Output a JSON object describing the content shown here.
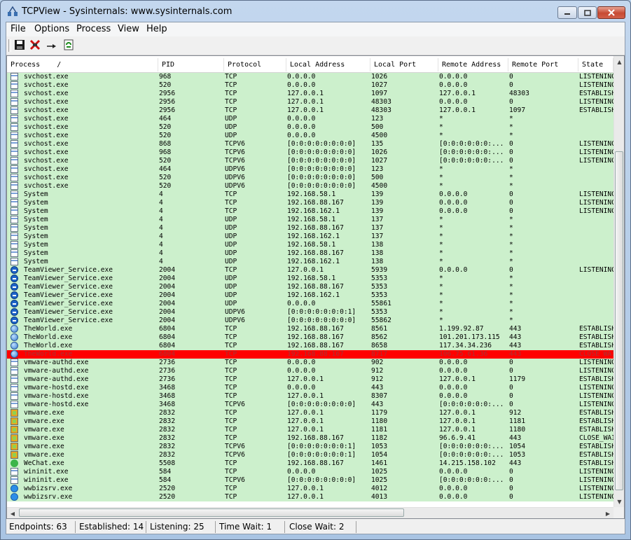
{
  "window": {
    "title": "TCPView - Sysinternals: www.sysinternals.com"
  },
  "menu": [
    "File",
    "Options",
    "Process",
    "View",
    "Help"
  ],
  "toolbar": [
    "save-icon",
    "close-connection-icon",
    "resolve-addresses-icon",
    "refresh-icon"
  ],
  "columns": [
    "Process",
    "PID",
    "Protocol",
    "Local Address",
    "Local Port",
    "Remote Address",
    "Remote Port",
    "State"
  ],
  "sort_indicator": "/",
  "rows": [
    {
      "icon": "win",
      "process": "svchost.exe",
      "pid": "968",
      "protocol": "TCP",
      "local_address": "0.0.0.0",
      "local_port": "1026",
      "remote_address": "0.0.0.0",
      "remote_port": "0",
      "state": "LISTENING"
    },
    {
      "icon": "win",
      "process": "svchost.exe",
      "pid": "520",
      "protocol": "TCP",
      "local_address": "0.0.0.0",
      "local_port": "1027",
      "remote_address": "0.0.0.0",
      "remote_port": "0",
      "state": "LISTENING"
    },
    {
      "icon": "win",
      "process": "svchost.exe",
      "pid": "2956",
      "protocol": "TCP",
      "local_address": "127.0.0.1",
      "local_port": "1097",
      "remote_address": "127.0.0.1",
      "remote_port": "48303",
      "state": "ESTABLISHED"
    },
    {
      "icon": "win",
      "process": "svchost.exe",
      "pid": "2956",
      "protocol": "TCP",
      "local_address": "127.0.0.1",
      "local_port": "48303",
      "remote_address": "0.0.0.0",
      "remote_port": "0",
      "state": "LISTENING"
    },
    {
      "icon": "win",
      "process": "svchost.exe",
      "pid": "2956",
      "protocol": "TCP",
      "local_address": "127.0.0.1",
      "local_port": "48303",
      "remote_address": "127.0.0.1",
      "remote_port": "1097",
      "state": "ESTABLISHED"
    },
    {
      "icon": "win",
      "process": "svchost.exe",
      "pid": "464",
      "protocol": "UDP",
      "local_address": "0.0.0.0",
      "local_port": "123",
      "remote_address": "*",
      "remote_port": "*",
      "state": ""
    },
    {
      "icon": "win",
      "process": "svchost.exe",
      "pid": "520",
      "protocol": "UDP",
      "local_address": "0.0.0.0",
      "local_port": "500",
      "remote_address": "*",
      "remote_port": "*",
      "state": ""
    },
    {
      "icon": "win",
      "process": "svchost.exe",
      "pid": "520",
      "protocol": "UDP",
      "local_address": "0.0.0.0",
      "local_port": "4500",
      "remote_address": "*",
      "remote_port": "*",
      "state": ""
    },
    {
      "icon": "win",
      "process": "svchost.exe",
      "pid": "868",
      "protocol": "TCPV6",
      "local_address": "[0:0:0:0:0:0:0:0]",
      "local_port": "135",
      "remote_address": "[0:0:0:0:0:0:...",
      "remote_port": "0",
      "state": "LISTENING"
    },
    {
      "icon": "win",
      "process": "svchost.exe",
      "pid": "968",
      "protocol": "TCPV6",
      "local_address": "[0:0:0:0:0:0:0:0]",
      "local_port": "1026",
      "remote_address": "[0:0:0:0:0:0:...",
      "remote_port": "0",
      "state": "LISTENING"
    },
    {
      "icon": "win",
      "process": "svchost.exe",
      "pid": "520",
      "protocol": "TCPV6",
      "local_address": "[0:0:0:0:0:0:0:0]",
      "local_port": "1027",
      "remote_address": "[0:0:0:0:0:0:...",
      "remote_port": "0",
      "state": "LISTENING"
    },
    {
      "icon": "win",
      "process": "svchost.exe",
      "pid": "464",
      "protocol": "UDPV6",
      "local_address": "[0:0:0:0:0:0:0:0]",
      "local_port": "123",
      "remote_address": "*",
      "remote_port": "*",
      "state": ""
    },
    {
      "icon": "win",
      "process": "svchost.exe",
      "pid": "520",
      "protocol": "UDPV6",
      "local_address": "[0:0:0:0:0:0:0:0]",
      "local_port": "500",
      "remote_address": "*",
      "remote_port": "*",
      "state": ""
    },
    {
      "icon": "win",
      "process": "svchost.exe",
      "pid": "520",
      "protocol": "UDPV6",
      "local_address": "[0:0:0:0:0:0:0:0]",
      "local_port": "4500",
      "remote_address": "*",
      "remote_port": "*",
      "state": ""
    },
    {
      "icon": "win",
      "process": "System",
      "pid": "4",
      "protocol": "TCP",
      "local_address": "192.168.58.1",
      "local_port": "139",
      "remote_address": "0.0.0.0",
      "remote_port": "0",
      "state": "LISTENING"
    },
    {
      "icon": "win",
      "process": "System",
      "pid": "4",
      "protocol": "TCP",
      "local_address": "192.168.88.167",
      "local_port": "139",
      "remote_address": "0.0.0.0",
      "remote_port": "0",
      "state": "LISTENING"
    },
    {
      "icon": "win",
      "process": "System",
      "pid": "4",
      "protocol": "TCP",
      "local_address": "192.168.162.1",
      "local_port": "139",
      "remote_address": "0.0.0.0",
      "remote_port": "0",
      "state": "LISTENING"
    },
    {
      "icon": "win",
      "process": "System",
      "pid": "4",
      "protocol": "UDP",
      "local_address": "192.168.58.1",
      "local_port": "137",
      "remote_address": "*",
      "remote_port": "*",
      "state": ""
    },
    {
      "icon": "win",
      "process": "System",
      "pid": "4",
      "protocol": "UDP",
      "local_address": "192.168.88.167",
      "local_port": "137",
      "remote_address": "*",
      "remote_port": "*",
      "state": ""
    },
    {
      "icon": "win",
      "process": "System",
      "pid": "4",
      "protocol": "UDP",
      "local_address": "192.168.162.1",
      "local_port": "137",
      "remote_address": "*",
      "remote_port": "*",
      "state": ""
    },
    {
      "icon": "win",
      "process": "System",
      "pid": "4",
      "protocol": "UDP",
      "local_address": "192.168.58.1",
      "local_port": "138",
      "remote_address": "*",
      "remote_port": "*",
      "state": ""
    },
    {
      "icon": "win",
      "process": "System",
      "pid": "4",
      "protocol": "UDP",
      "local_address": "192.168.88.167",
      "local_port": "138",
      "remote_address": "*",
      "remote_port": "*",
      "state": ""
    },
    {
      "icon": "win",
      "process": "System",
      "pid": "4",
      "protocol": "UDP",
      "local_address": "192.168.162.1",
      "local_port": "138",
      "remote_address": "*",
      "remote_port": "*",
      "state": ""
    },
    {
      "icon": "tv",
      "process": "TeamViewer_Service.exe",
      "pid": "2004",
      "protocol": "TCP",
      "local_address": "127.0.0.1",
      "local_port": "5939",
      "remote_address": "0.0.0.0",
      "remote_port": "0",
      "state": "LISTENING"
    },
    {
      "icon": "tv",
      "process": "TeamViewer_Service.exe",
      "pid": "2004",
      "protocol": "UDP",
      "local_address": "192.168.58.1",
      "local_port": "5353",
      "remote_address": "*",
      "remote_port": "*",
      "state": ""
    },
    {
      "icon": "tv",
      "process": "TeamViewer_Service.exe",
      "pid": "2004",
      "protocol": "UDP",
      "local_address": "192.168.88.167",
      "local_port": "5353",
      "remote_address": "*",
      "remote_port": "*",
      "state": ""
    },
    {
      "icon": "tv",
      "process": "TeamViewer_Service.exe",
      "pid": "2004",
      "protocol": "UDP",
      "local_address": "192.168.162.1",
      "local_port": "5353",
      "remote_address": "*",
      "remote_port": "*",
      "state": ""
    },
    {
      "icon": "tv",
      "process": "TeamViewer_Service.exe",
      "pid": "2004",
      "protocol": "UDP",
      "local_address": "0.0.0.0",
      "local_port": "55861",
      "remote_address": "*",
      "remote_port": "*",
      "state": ""
    },
    {
      "icon": "tv",
      "process": "TeamViewer_Service.exe",
      "pid": "2004",
      "protocol": "UDPV6",
      "local_address": "[0:0:0:0:0:0:0:1]",
      "local_port": "5353",
      "remote_address": "*",
      "remote_port": "*",
      "state": ""
    },
    {
      "icon": "tv",
      "process": "TeamViewer_Service.exe",
      "pid": "2004",
      "protocol": "UDPV6",
      "local_address": "[0:0:0:0:0:0:0:0]",
      "local_port": "55862",
      "remote_address": "*",
      "remote_port": "*",
      "state": ""
    },
    {
      "icon": "world",
      "process": "TheWorld.exe",
      "pid": "6804",
      "protocol": "TCP",
      "local_address": "192.168.88.167",
      "local_port": "8561",
      "remote_address": "1.199.92.87",
      "remote_port": "443",
      "state": "ESTABLISHED"
    },
    {
      "icon": "world",
      "process": "TheWorld.exe",
      "pid": "6804",
      "protocol": "TCP",
      "local_address": "192.168.88.167",
      "local_port": "8562",
      "remote_address": "101.201.173.115",
      "remote_port": "443",
      "state": "ESTABLISHED"
    },
    {
      "icon": "world",
      "process": "TheWorld.exe",
      "pid": "6804",
      "protocol": "TCP",
      "local_address": "192.168.88.167",
      "local_port": "8658",
      "remote_address": "117.34.34.236",
      "remote_port": "443",
      "state": "ESTABLISHED"
    },
    {
      "icon": "world",
      "process": "TheWorld.exe",
      "pid": "6804",
      "protocol": "TCP",
      "local_address": "192.168.88.167",
      "local_port": "8717",
      "remote_address": "106.75.61.36",
      "remote_port": "443",
      "state": "CLOSE_WAIT",
      "selected": true
    },
    {
      "icon": "win",
      "process": "vmware-authd.exe",
      "pid": "2736",
      "protocol": "TCP",
      "local_address": "0.0.0.0",
      "local_port": "902",
      "remote_address": "0.0.0.0",
      "remote_port": "0",
      "state": "LISTENING"
    },
    {
      "icon": "win",
      "process": "vmware-authd.exe",
      "pid": "2736",
      "protocol": "TCP",
      "local_address": "0.0.0.0",
      "local_port": "912",
      "remote_address": "0.0.0.0",
      "remote_port": "0",
      "state": "LISTENING"
    },
    {
      "icon": "win",
      "process": "vmware-authd.exe",
      "pid": "2736",
      "protocol": "TCP",
      "local_address": "127.0.0.1",
      "local_port": "912",
      "remote_address": "127.0.0.1",
      "remote_port": "1179",
      "state": "ESTABLISHED"
    },
    {
      "icon": "win",
      "process": "vmware-hostd.exe",
      "pid": "3468",
      "protocol": "TCP",
      "local_address": "0.0.0.0",
      "local_port": "443",
      "remote_address": "0.0.0.0",
      "remote_port": "0",
      "state": "LISTENING"
    },
    {
      "icon": "win",
      "process": "vmware-hostd.exe",
      "pid": "3468",
      "protocol": "TCP",
      "local_address": "127.0.0.1",
      "local_port": "8307",
      "remote_address": "0.0.0.0",
      "remote_port": "0",
      "state": "LISTENING"
    },
    {
      "icon": "win",
      "process": "vmware-hostd.exe",
      "pid": "3468",
      "protocol": "TCPV6",
      "local_address": "[0:0:0:0:0:0:0:0]",
      "local_port": "443",
      "remote_address": "[0:0:0:0:0:0:...",
      "remote_port": "0",
      "state": "LISTENING"
    },
    {
      "icon": "vm",
      "process": "vmware.exe",
      "pid": "2832",
      "protocol": "TCP",
      "local_address": "127.0.0.1",
      "local_port": "1179",
      "remote_address": "127.0.0.1",
      "remote_port": "912",
      "state": "ESTABLISHED"
    },
    {
      "icon": "vm",
      "process": "vmware.exe",
      "pid": "2832",
      "protocol": "TCP",
      "local_address": "127.0.0.1",
      "local_port": "1180",
      "remote_address": "127.0.0.1",
      "remote_port": "1181",
      "state": "ESTABLISHED"
    },
    {
      "icon": "vm",
      "process": "vmware.exe",
      "pid": "2832",
      "protocol": "TCP",
      "local_address": "127.0.0.1",
      "local_port": "1181",
      "remote_address": "127.0.0.1",
      "remote_port": "1180",
      "state": "ESTABLISHED"
    },
    {
      "icon": "vm",
      "process": "vmware.exe",
      "pid": "2832",
      "protocol": "TCP",
      "local_address": "192.168.88.167",
      "local_port": "1182",
      "remote_address": "96.6.9.41",
      "remote_port": "443",
      "state": "CLOSE_WAIT"
    },
    {
      "icon": "vm",
      "process": "vmware.exe",
      "pid": "2832",
      "protocol": "TCPV6",
      "local_address": "[0:0:0:0:0:0:0:1]",
      "local_port": "1053",
      "remote_address": "[0:0:0:0:0:0:...",
      "remote_port": "1054",
      "state": "ESTABLISHED"
    },
    {
      "icon": "vm",
      "process": "vmware.exe",
      "pid": "2832",
      "protocol": "TCPV6",
      "local_address": "[0:0:0:0:0:0:0:1]",
      "local_port": "1054",
      "remote_address": "[0:0:0:0:0:0:...",
      "remote_port": "1053",
      "state": "ESTABLISHED"
    },
    {
      "icon": "wechat",
      "process": "WeChat.exe",
      "pid": "5508",
      "protocol": "TCP",
      "local_address": "192.168.88.167",
      "local_port": "1461",
      "remote_address": "14.215.158.102",
      "remote_port": "443",
      "state": "ESTABLISHED"
    },
    {
      "icon": "win",
      "process": "wininit.exe",
      "pid": "584",
      "protocol": "TCP",
      "local_address": "0.0.0.0",
      "local_port": "1025",
      "remote_address": "0.0.0.0",
      "remote_port": "0",
      "state": "LISTENING"
    },
    {
      "icon": "win",
      "process": "wininit.exe",
      "pid": "584",
      "protocol": "TCPV6",
      "local_address": "[0:0:0:0:0:0:0:0]",
      "local_port": "1025",
      "remote_address": "[0:0:0:0:0:0:...",
      "remote_port": "0",
      "state": "LISTENING"
    },
    {
      "icon": "wwb",
      "process": "wwbizsrv.exe",
      "pid": "2520",
      "protocol": "TCP",
      "local_address": "127.0.0.1",
      "local_port": "4012",
      "remote_address": "0.0.0.0",
      "remote_port": "0",
      "state": "LISTENING"
    },
    {
      "icon": "wwb",
      "process": "wwbizsrv.exe",
      "pid": "2520",
      "protocol": "TCP",
      "local_address": "127.0.0.1",
      "local_port": "4013",
      "remote_address": "0.0.0.0",
      "remote_port": "0",
      "state": "LISTENING"
    }
  ],
  "status": {
    "endpoints": "Endpoints: 63",
    "established": "Established: 14",
    "listening": "Listening: 25",
    "time_wait": "Time Wait: 1",
    "close_wait": "Close Wait: 2"
  },
  "colors": {
    "row_bg": "#ccf0cc",
    "selected_bg": "#ff0000",
    "selected_text": "#aa3333"
  }
}
